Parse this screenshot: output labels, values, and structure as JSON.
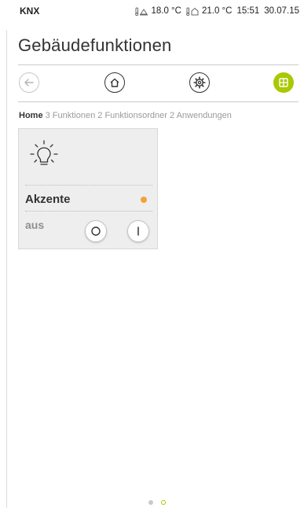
{
  "status_bar": {
    "app_name": "KNX",
    "outdoor_temp": "18.0 °C",
    "indoor_temp": "21.0 °C",
    "time": "15:51",
    "date": "30.07.15"
  },
  "page": {
    "title": "Gebäudefunktionen"
  },
  "nav": {
    "icons": [
      "back-arrow-icon",
      "home-icon",
      "settings-gear-icon",
      "grid-icon"
    ],
    "accent_color": "#a9c800"
  },
  "breadcrumb": {
    "home": "Home",
    "rest": "3 Funktionen 2 Funktionsordner 2 Anwendungen"
  },
  "tile": {
    "icon": "light-bulb-icon",
    "name": "Akzente",
    "state": "aus",
    "led_color": "#f2a23a"
  },
  "pager": {
    "pages": 2,
    "current": 2
  }
}
